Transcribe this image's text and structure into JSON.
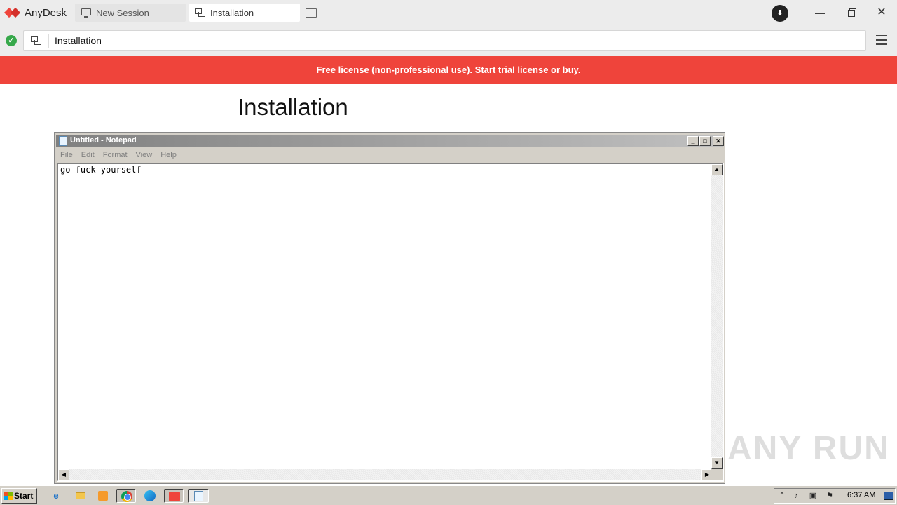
{
  "app": {
    "name": "AnyDesk",
    "brand_color": "#ef443b"
  },
  "tabs": [
    {
      "label": "New Session",
      "icon": "monitor-icon",
      "active": false
    },
    {
      "label": "Installation",
      "icon": "remote-session-icon",
      "active": true
    }
  ],
  "address_bar": {
    "value": "Installation",
    "status": "connected"
  },
  "banner": {
    "prefix": "Free license (non-professional use). ",
    "trial_link": "Start trial license",
    "middle": " or ",
    "buy_link": "buy",
    "suffix": ".",
    "color": "#ef443b"
  },
  "remote": {
    "page_title": "Installation",
    "notepad": {
      "title": "Untitled - Notepad",
      "menu": [
        "File",
        "Edit",
        "Format",
        "View",
        "Help"
      ],
      "content": "go fuck yourself"
    },
    "watermark": "ANY RUN",
    "taskbar": {
      "start_label": "Start",
      "clock": "6:37 AM"
    }
  }
}
